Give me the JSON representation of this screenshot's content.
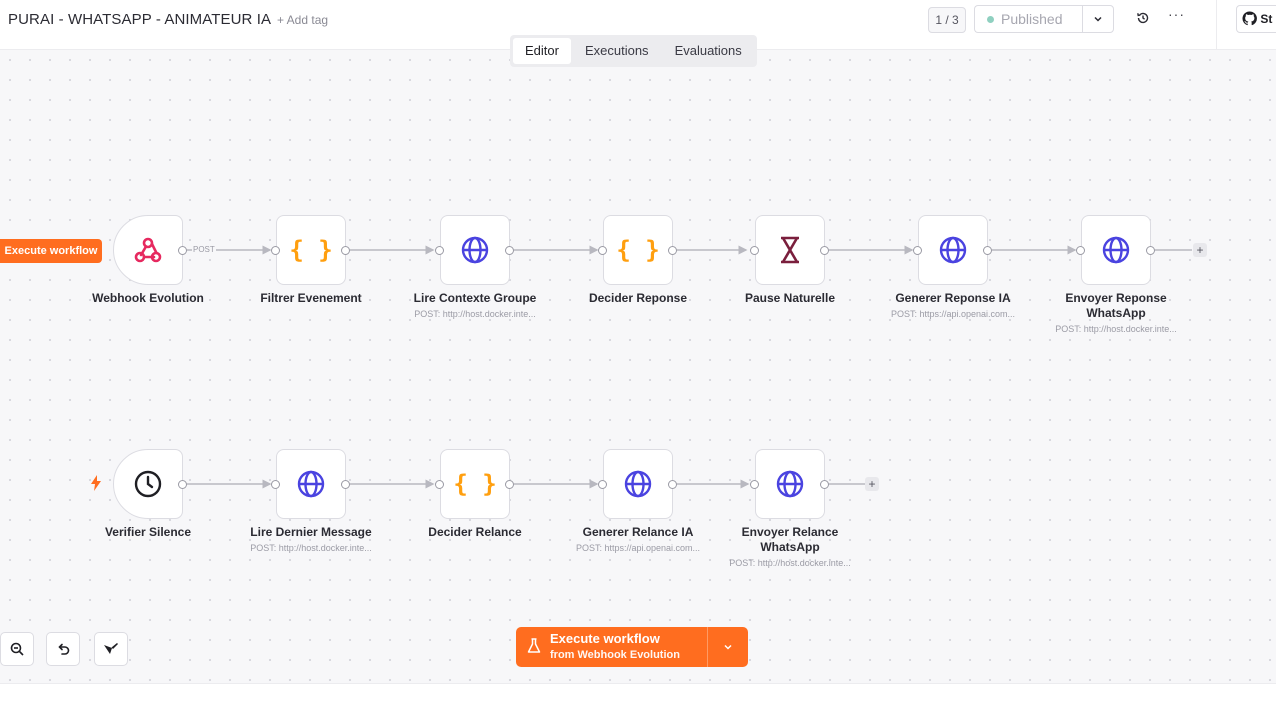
{
  "header": {
    "workflow_title": "PURAI - WHATSAPP - ANIMATEUR IA",
    "add_tag": "+ Add tag",
    "version": "1 / 3",
    "publish_status": "Published",
    "more": "···",
    "github_label": "St",
    "icons": [
      "chevron-down-icon",
      "history-icon",
      "more-icon",
      "github-icon"
    ]
  },
  "tabs": {
    "editor": "Editor",
    "executions": "Executions",
    "evaluations": "Evaluations",
    "active": "Editor"
  },
  "canvas": {
    "execute_workflow_tag": "Execute workflow",
    "post_label": "POST",
    "add_node": "+",
    "row1": [
      {
        "label": "Webhook Evolution",
        "subtitle": "",
        "icon": "webhook-icon"
      },
      {
        "label": "Filtrer Evenement",
        "subtitle": "",
        "icon": "code-braces-icon"
      },
      {
        "label": "Lire Contexte Groupe",
        "subtitle": "POST: http://host.docker.inte...",
        "icon": "globe-icon"
      },
      {
        "label": "Decider Reponse",
        "subtitle": "",
        "icon": "code-braces-icon"
      },
      {
        "label": "Pause Naturelle",
        "subtitle": "",
        "icon": "hourglass-icon"
      },
      {
        "label": "Generer Reponse IA",
        "subtitle": "POST: https://api.openai.com...",
        "icon": "globe-icon"
      },
      {
        "label": "Envoyer Reponse WhatsApp",
        "subtitle": "POST: http://host.docker.inte...",
        "icon": "globe-icon"
      }
    ],
    "row2": [
      {
        "label": "Verifier Silence",
        "subtitle": "",
        "icon": "clock-icon"
      },
      {
        "label": "Lire Dernier Message",
        "subtitle": "POST: http://host.docker.inte...",
        "icon": "globe-icon"
      },
      {
        "label": "Decider Relance",
        "subtitle": "",
        "icon": "code-braces-icon"
      },
      {
        "label": "Generer Relance IA",
        "subtitle": "POST: https://api.openai.com...",
        "icon": "globe-icon"
      },
      {
        "label": "Envoyer Relance WhatsApp",
        "subtitle": "POST: http://host.docker.inte...",
        "icon": "globe-icon"
      }
    ]
  },
  "run": {
    "label": "Execute workflow",
    "from": "from Webhook Evolution"
  },
  "colors": {
    "accent": "#ff6d1f",
    "globe": "#4a43e0",
    "code": "#ff9f0f",
    "webhook": "#e6295f",
    "hourglass": "#7a1f3d"
  }
}
